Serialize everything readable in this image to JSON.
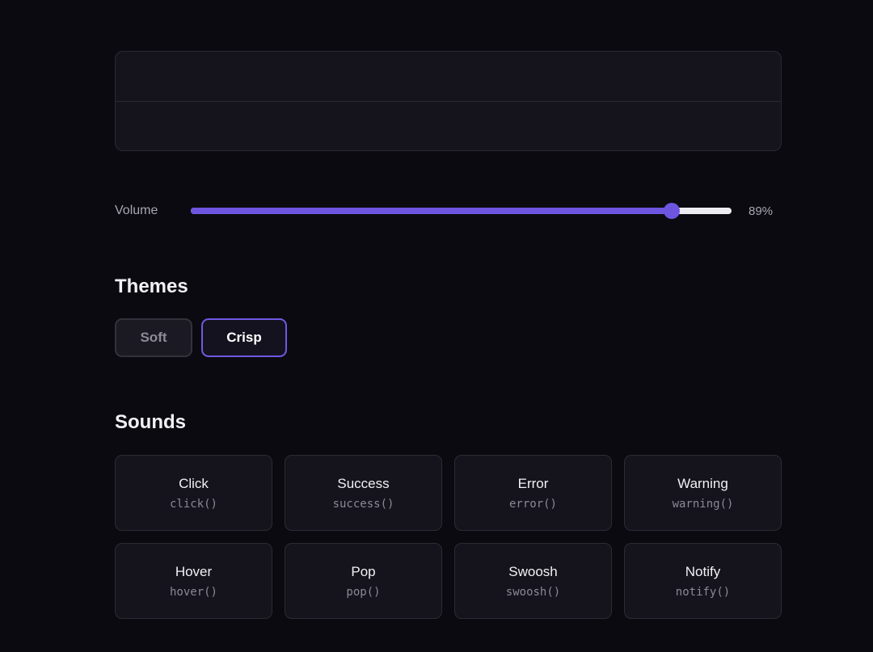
{
  "volume": {
    "label": "Volume",
    "value_text": "89%",
    "value": 0.89
  },
  "themes": {
    "heading": "Themes",
    "options": [
      {
        "label": "Soft",
        "selected": false
      },
      {
        "label": "Crisp",
        "selected": true
      }
    ]
  },
  "sounds": {
    "heading": "Sounds",
    "items": [
      {
        "name": "Click",
        "fn": "click()"
      },
      {
        "name": "Success",
        "fn": "success()"
      },
      {
        "name": "Error",
        "fn": "error()"
      },
      {
        "name": "Warning",
        "fn": "warning()"
      },
      {
        "name": "Hover",
        "fn": "hover()"
      },
      {
        "name": "Pop",
        "fn": "pop()"
      },
      {
        "name": "Swoosh",
        "fn": "swoosh()"
      },
      {
        "name": "Notify",
        "fn": "notify()"
      }
    ]
  },
  "colors": {
    "accent": "#6e55e0",
    "background": "#0b0a10",
    "card": "#15141d"
  }
}
